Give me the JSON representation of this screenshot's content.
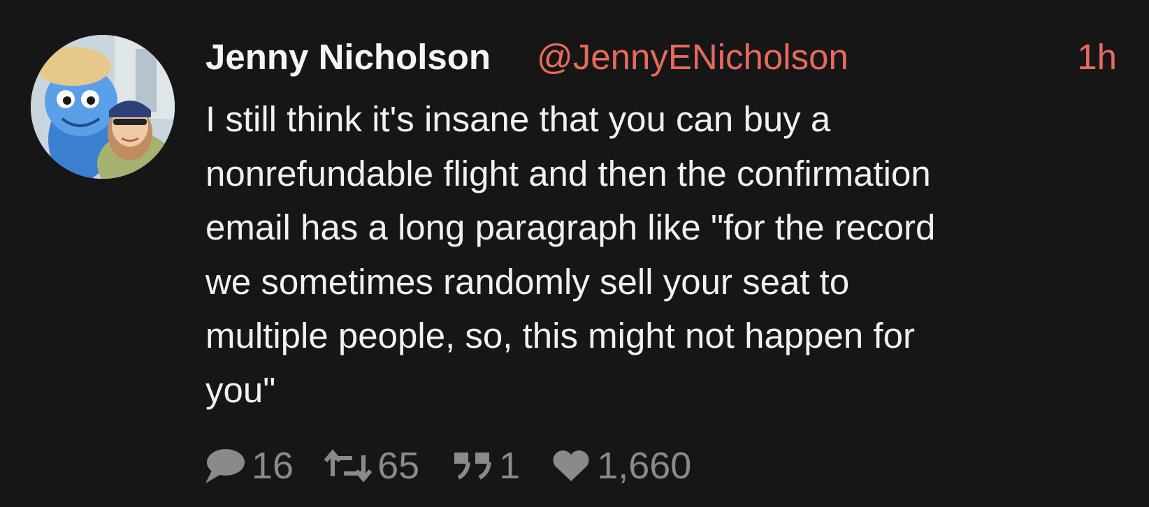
{
  "tweet": {
    "author_name": "Jenny Nicholson",
    "author_handle": "@JennyENicholson",
    "time_ago": "1h",
    "text_lines": [
      "I still think it's insane that you can buy a",
      "nonrefundable flight and then the confirmation",
      "email has a long paragraph like \"for the record",
      "we sometimes randomly sell your seat to",
      "multiple people, so, this might not happen for",
      "you\""
    ],
    "stats": {
      "replies": "16",
      "retweets": "65",
      "quotes": "1",
      "likes": "1,660"
    }
  },
  "icons": {
    "reply": "speech-bubble-icon",
    "retweet": "retweet-icon",
    "quote": "quote-icon",
    "like": "heart-icon"
  },
  "colors": {
    "background": "#161616",
    "accent": "#e96a5d",
    "text": "#f1f1f1",
    "muted": "#8a8a8a"
  }
}
